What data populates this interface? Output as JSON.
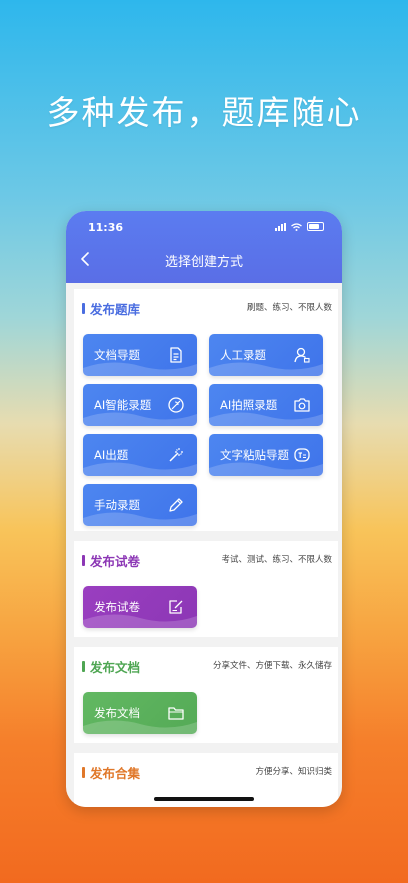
{
  "headline": "多种发布，题库随心",
  "status": {
    "time": "11:36"
  },
  "nav": {
    "title": "选择创建方式"
  },
  "sections": [
    {
      "title": "发布题库",
      "desc": "刷题、练习、不限人数",
      "color": "#4a6de0",
      "tiles": [
        {
          "label": "文档导题",
          "icon": "document-icon"
        },
        {
          "label": "人工录题",
          "icon": "person-edit-icon"
        },
        {
          "label": "AI智能录题",
          "icon": "ai-leaf-icon"
        },
        {
          "label": "AI拍照录题",
          "icon": "camera-icon"
        },
        {
          "label": "AI出题",
          "icon": "magic-wand-icon"
        },
        {
          "label": "文字粘贴导题",
          "icon": "text-paste-icon"
        },
        {
          "label": "手动录题",
          "icon": "pencil-icon"
        }
      ]
    },
    {
      "title": "发布试卷",
      "desc": "考试、测试、练习、不限人数",
      "color": "#8c37b5",
      "tiles": [
        {
          "label": "发布试卷",
          "icon": "exam-edit-icon"
        }
      ]
    },
    {
      "title": "发布文档",
      "desc": "分享文件、方便下载、永久储存",
      "color": "#4fa653",
      "tiles": [
        {
          "label": "发布文档",
          "icon": "folder-icon"
        }
      ]
    },
    {
      "title": "发布合集",
      "desc": "方便分享、知识归类",
      "color": "#e0782a",
      "tiles": []
    }
  ]
}
